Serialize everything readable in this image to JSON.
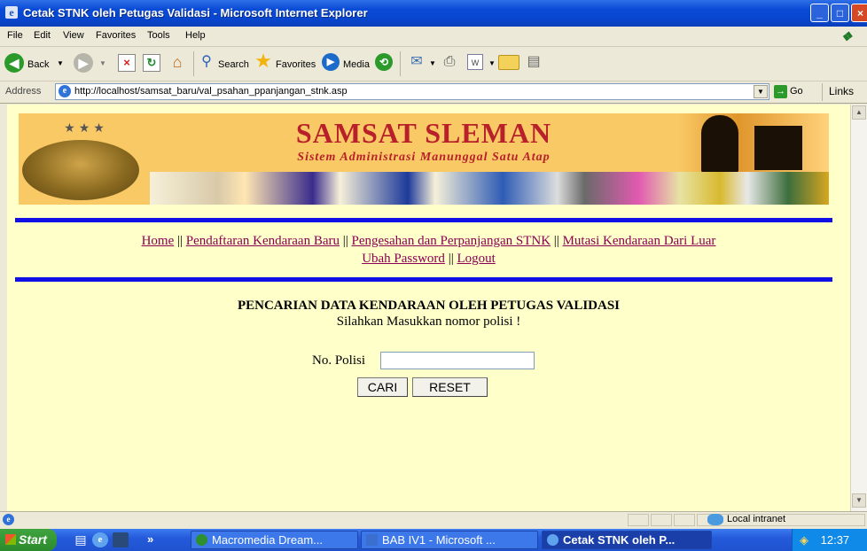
{
  "window": {
    "title": "Cetak STNK oleh Petugas Validasi - Microsoft Internet Explorer",
    "min": "_",
    "max": "□",
    "close": "×"
  },
  "menu": [
    "File",
    "Edit",
    "View",
    "Favorites",
    "Tools",
    "Help"
  ],
  "toolbar": {
    "back": "Back",
    "search": "Search",
    "favorites": "Favorites",
    "media": "Media"
  },
  "address": {
    "label": "Address",
    "url": "http://localhost/samsat_baru/val_psahan_ppanjangan_stnk.asp",
    "go": "Go",
    "links": "Links"
  },
  "banner": {
    "title": "SAMSAT SLEMAN",
    "subtitle": "Sistem Administrasi Manunggal Satu Atap"
  },
  "nav": {
    "home": "Home",
    "pendaftaran": "Pendaftaran Kendaraan Baru",
    "pengesahan": "Pengesahan dan Perpanjangan STNK",
    "mutasi": "Mutasi Kendaraan Dari Luar",
    "ubah_password": "Ubah Password",
    "logout": "Logout",
    "sep": "||"
  },
  "search_form": {
    "heading": "PENCARIAN DATA KENDARAAN OLEH PETUGAS VALIDASI",
    "instruction": "Silahkan Masukkan nomor polisi !",
    "polisi_label": "No. Polisi",
    "polisi_value": "",
    "cari": "CARI",
    "reset": "RESET"
  },
  "status": {
    "zone": "Local intranet"
  },
  "taskbar": {
    "start": "Start",
    "items": [
      "Macromedia Dream...",
      "BAB IV1 - Microsoft ...",
      "Cetak STNK oleh P..."
    ],
    "clock": "12:37"
  }
}
